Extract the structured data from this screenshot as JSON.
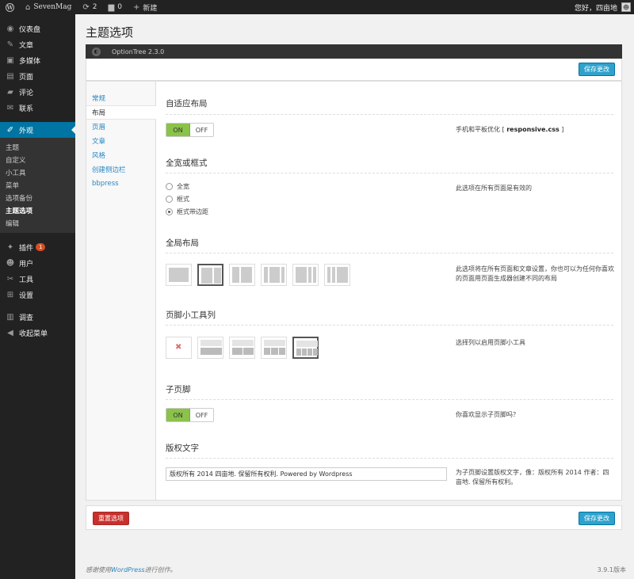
{
  "adminbar": {
    "site_name": "SevenMag",
    "updates_count": "2",
    "comments_count": "0",
    "new_label": "新建",
    "greeting": "您好，四亩地"
  },
  "sidebar": {
    "items_top": [
      {
        "label": "仪表盘",
        "icon": "dashboard-icon",
        "glyph": "◉"
      },
      {
        "label": "文章",
        "icon": "pin-icon",
        "glyph": "✎"
      },
      {
        "label": "多媒体",
        "icon": "media-icon",
        "glyph": "▣"
      },
      {
        "label": "页面",
        "icon": "page-icon",
        "glyph": "▤"
      },
      {
        "label": "评论",
        "icon": "comment-icon",
        "glyph": "▰"
      },
      {
        "label": "联系",
        "icon": "contact-icon",
        "glyph": "✉"
      }
    ],
    "current": {
      "label": "外观",
      "icon": "appearance-icon",
      "glyph": "✐"
    },
    "submenu": [
      "主题",
      "自定义",
      "小工具",
      "菜单",
      "选项备份",
      "主题选项",
      "编辑"
    ],
    "items_bottom": [
      {
        "label": "插件",
        "icon": "plugin-icon",
        "glyph": "✦",
        "badge": "1"
      },
      {
        "label": "用户",
        "icon": "user-icon",
        "glyph": "☻"
      },
      {
        "label": "工具",
        "icon": "tool-icon",
        "glyph": "✂"
      },
      {
        "label": "设置",
        "icon": "settings-icon",
        "glyph": "⊞"
      }
    ],
    "items_extra": [
      {
        "label": "调查",
        "icon": "survey-icon",
        "glyph": "▥"
      },
      {
        "label": "收起菜单",
        "icon": "collapse-icon",
        "glyph": "◀"
      }
    ]
  },
  "page": {
    "title": "主题选项",
    "ot_version": "OptionTree 2.3.0",
    "save_label": "保存更改",
    "reset_label": "重置选项"
  },
  "tabs": [
    "常规",
    "布局",
    "页眉",
    "文章",
    "风格",
    "创建侧边栏",
    "bbpress"
  ],
  "sections": {
    "responsive": {
      "title": "自适应布局",
      "on": "ON",
      "off": "OFF",
      "desc_prefix": "手机和平板优化 [ ",
      "desc_code": "responsive.css",
      "desc_suffix": " ]"
    },
    "width": {
      "title": "全宽或框式",
      "options": [
        "全宽",
        "框式",
        "框式带边距"
      ],
      "selected_index": 2,
      "desc": "此选项在所有页面是有效的"
    },
    "global_layout": {
      "title": "全局布局",
      "desc": "此选项将在所有页面和文章设置，你也可以为任何你喜欢的页面用页面生成器创建不同的布局"
    },
    "footer_widgets": {
      "title": "页脚小工具列",
      "desc": "选择列以启用页脚小工具"
    },
    "subfooter": {
      "title": "子页脚",
      "on": "ON",
      "off": "OFF",
      "desc": "你喜欢显示子页脚吗？"
    },
    "copyright": {
      "title": "版权文字",
      "value": "版权所有 2014 四亩地. 保留所有权利. Powered by Wordpress",
      "desc": "为子页脚设置版权文字，像：版权所有 2014 作者：四亩地. 保留所有权利。"
    }
  },
  "footer": {
    "thanks_prefix": "感谢使用",
    "thanks_link": "WordPress",
    "thanks_suffix": "进行创作。",
    "version": "3.9.1版本"
  },
  "colors": {
    "admin_dark": "#222222",
    "current_menu": "#0074a2",
    "button_primary": "#2ea2cc",
    "button_reset": "#c9302c",
    "toggle_on": "#8ac24a"
  }
}
